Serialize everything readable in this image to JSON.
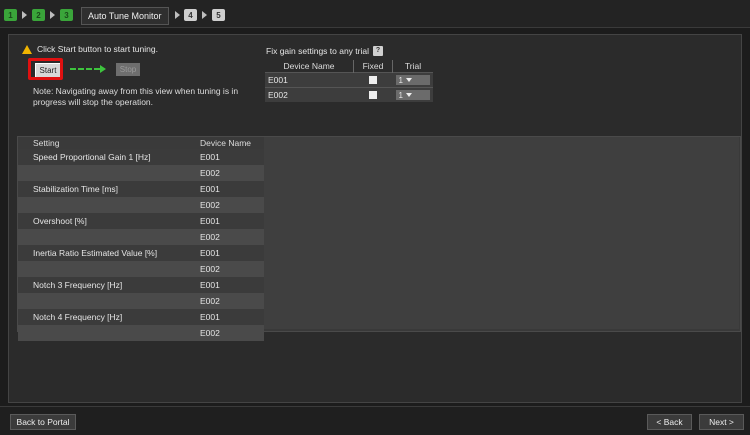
{
  "breadcrumb": {
    "steps": [
      "1",
      "2",
      "3",
      "4",
      "5"
    ],
    "current_label": "Auto Tune Monitor"
  },
  "tuning": {
    "instruction": "Click Start button to start tuning.",
    "start_label": "Start",
    "stop_label": "Stop",
    "note": "Note: Navigating away from this view when tuning is in progress will stop the operation."
  },
  "fix_gain": {
    "title": "Fix gain settings to any trial",
    "help": "?",
    "headers": [
      "Device Name",
      "Fixed",
      "Trial"
    ],
    "rows": [
      {
        "device": "E001",
        "trial": "1"
      },
      {
        "device": "E002",
        "trial": "1"
      }
    ]
  },
  "settings_table": {
    "headers": [
      "Setting",
      "Device Name"
    ],
    "rows": [
      {
        "setting": "Speed Proportional Gain 1 [Hz]",
        "device": "E001"
      },
      {
        "setting": "",
        "device": "E002"
      },
      {
        "setting": "Stabilization Time [ms]",
        "device": "E001"
      },
      {
        "setting": "",
        "device": "E002"
      },
      {
        "setting": "Overshoot [%]",
        "device": "E001"
      },
      {
        "setting": "",
        "device": "E002"
      },
      {
        "setting": "Inertia Ratio Estimated Value [%]",
        "device": "E001"
      },
      {
        "setting": "",
        "device": "E002"
      },
      {
        "setting": "Notch 3 Frequency [Hz]",
        "device": "E001"
      },
      {
        "setting": "",
        "device": "E002"
      },
      {
        "setting": "Notch 4 Frequency [Hz]",
        "device": "E001"
      },
      {
        "setting": "",
        "device": "E002"
      }
    ]
  },
  "footer": {
    "back_to_portal": "Back to Portal",
    "back": "< Back",
    "next": "Next >"
  },
  "colors": {
    "accent_green": "#3aa53a",
    "highlight_red": "#e01010",
    "warning": "#f0b400"
  }
}
